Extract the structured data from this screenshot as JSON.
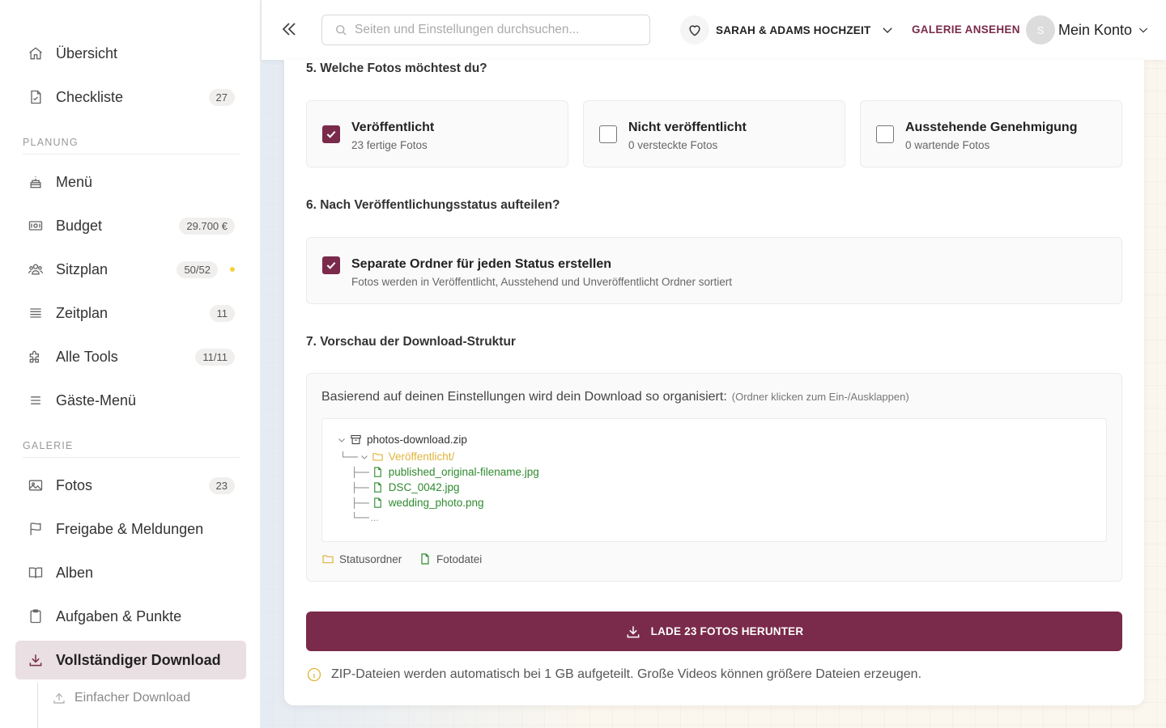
{
  "sidebar": {
    "items": [
      {
        "label": "Übersicht",
        "icon": "home-icon"
      },
      {
        "label": "Checkliste",
        "icon": "document-check-icon",
        "badge": "27"
      }
    ],
    "planning": {
      "section_label": "PLANUNG",
      "items": [
        {
          "label": "Menü",
          "icon": "cake-icon"
        },
        {
          "label": "Budget",
          "icon": "banknote-icon",
          "badge": "29.700 €"
        },
        {
          "label": "Sitzplan",
          "icon": "users-icon",
          "badge": "50/52"
        },
        {
          "label": "Zeitplan",
          "icon": "list-lines-icon",
          "badge": "11"
        },
        {
          "label": "Alle Tools",
          "icon": "puzzle-icon",
          "badge": "11/11"
        },
        {
          "label": "Gäste-Menü",
          "icon": "menu-icon"
        }
      ]
    },
    "gallery": {
      "section_label": "GALERIE",
      "items": [
        {
          "label": "Fotos",
          "icon": "image-icon",
          "badge": "23"
        },
        {
          "label": "Freigabe & Meldungen",
          "icon": "flag-icon"
        },
        {
          "label": "Alben",
          "icon": "book-open-icon"
        },
        {
          "label": "Aufgaben & Punkte",
          "icon": "clipboard-icon"
        },
        {
          "label": "Vollständiger Download",
          "icon": "download-icon",
          "active": true
        }
      ],
      "sub_item": {
        "label": "Einfacher Download",
        "icon": "upload-icon"
      }
    }
  },
  "header": {
    "search_placeholder": "Seiten und Einstellungen durchsuchen...",
    "wedding_name": "SARAH & ADAMS HOCHZEIT",
    "gallery_link": "GALERIE ANSEHEN",
    "avatar_initial": "S",
    "account_label": "Mein Konto"
  },
  "main": {
    "q5": {
      "title": "5. Welche Fotos möchtest du?",
      "options": [
        {
          "title": "Veröffentlicht",
          "subtitle": "23 fertige Fotos",
          "checked": true
        },
        {
          "title": "Nicht veröffentlicht",
          "subtitle": "0 versteckte Fotos",
          "checked": false
        },
        {
          "title": "Ausstehende Genehmigung",
          "subtitle": "0 wartende Fotos",
          "checked": false
        }
      ]
    },
    "q6": {
      "title": "6. Nach Veröffentlichungsstatus aufteilen?",
      "option": {
        "title": "Separate Ordner für jeden Status erstellen",
        "subtitle": "Fotos werden in Veröffentlicht, Ausstehend und Unveröffentlicht Ordner sortiert",
        "checked": true
      }
    },
    "q7": {
      "title": "7. Vorschau der Download-Struktur",
      "intro": "Basierend auf deinen Einstellungen wird dein Download so organisiert:",
      "hint": "(Ordner klicken zum Ein-/Ausklappen)",
      "tree": {
        "root": "photos-download.zip",
        "folder": "Veröffentlicht/",
        "files": [
          "published_original-filename.jpg",
          "DSC_0042.jpg",
          "wedding_photo.png"
        ],
        "more": "..."
      },
      "legend": {
        "folder": "Statusordner",
        "file": "Fotodatei"
      }
    },
    "download_button": "LADE 23 FOTOS HERUNTER",
    "info_text": "ZIP-Dateien werden automatisch bei 1 GB aufgeteilt. Große Videos können größere Dateien erzeugen."
  },
  "colors": {
    "accent": "#7a2a4a",
    "folder": "#e0b43a",
    "file": "#2f8a2f"
  }
}
